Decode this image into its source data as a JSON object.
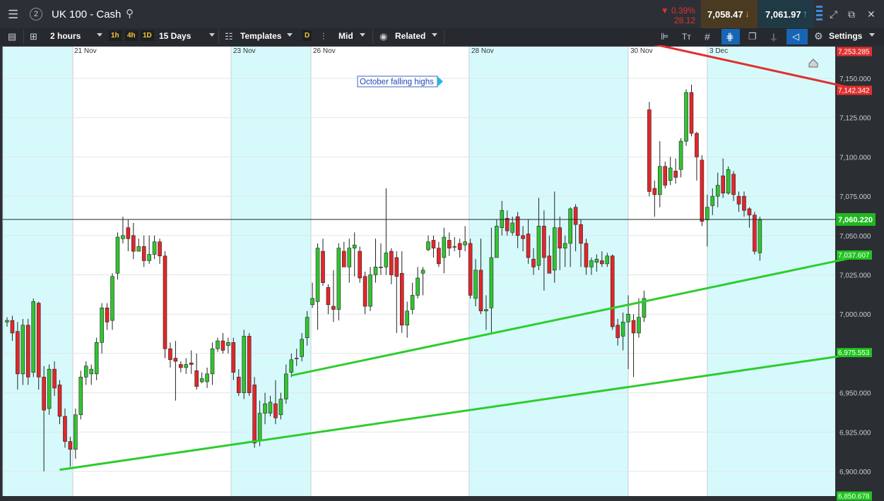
{
  "header": {
    "workspace_number": "2",
    "instrument": "UK 100 - Cash",
    "change_percent": "0.39%",
    "change_points": "28.12",
    "sell_price": "7,058.47",
    "buy_price": "7,061.97",
    "colors": {
      "down": "#e0302f",
      "sell_bg": "#4a3a22",
      "buy_bg": "#1f3a45"
    }
  },
  "toolbar": {
    "interval": "2 hours",
    "timeframes": [
      "1h",
      "4h",
      "1D"
    ],
    "range": "15 Days",
    "templates_label": "Templates",
    "d_badge": "D",
    "price_mode": "Mid",
    "related_label": "Related",
    "settings_label": "Settings"
  },
  "chart_data": {
    "type": "candlestick",
    "ylim": [
      6850,
      7270
    ],
    "y_ticks": [
      "7,150.000",
      "7,125.000",
      "7,100.000",
      "7,075.000",
      "7,050.000",
      "7,025.000",
      "7,000.000",
      "6,975.000",
      "6,950.000",
      "6,925.000",
      "6,900.000"
    ],
    "y_tick_values": [
      7150,
      7125,
      7100,
      7075,
      7050,
      7025,
      7000,
      6975,
      6950,
      6925,
      6900
    ],
    "x_labels": [
      "21 Nov",
      "23 Nov",
      "26 Nov",
      "28 Nov",
      "30 Nov",
      "3 Dec"
    ],
    "shaded_days": 6,
    "current_price": 7060.22,
    "current_price_label": "7,060.220",
    "annotation": "October falling highs",
    "price_tags": [
      {
        "label": "7,253.285",
        "value": 7253.285,
        "color": "#e0302f"
      },
      {
        "label": "7,142.342",
        "value": 7142.342,
        "color": "#e0302f"
      },
      {
        "label": "7,037.607",
        "value": 7037.607,
        "color": "#1fc31f"
      },
      {
        "label": "6,975.553",
        "value": 6975.553,
        "color": "#1fc31f"
      },
      {
        "label": "6,850.678",
        "value": 6850.678,
        "color": "#1fc31f"
      }
    ],
    "trendlines": [
      {
        "name": "resistance",
        "color": "#e0302f",
        "from": [
          13,
          7253
        ],
        "to": [
          163,
          7142
        ]
      },
      {
        "name": "support-upper",
        "color": "#2ecc2e",
        "from": [
          54,
          6961
        ],
        "to": [
          163,
          7037.6
        ]
      },
      {
        "name": "support-lower",
        "color": "#2ecc2e",
        "from": [
          10,
          6901
        ],
        "to": [
          163,
          6975.6
        ]
      }
    ],
    "candles": [
      [
        6995,
        6996,
        6998,
        6992
      ],
      [
        6996,
        6988,
        6999,
        6983
      ],
      [
        6989,
        6962,
        6995,
        6952
      ],
      [
        6962,
        6993,
        6997,
        6955
      ],
      [
        6993,
        6960,
        6997,
        6955
      ],
      [
        6963,
        7008,
        7010,
        6960
      ],
      [
        7007,
        6960,
        7008,
        6952
      ],
      [
        6960,
        6939,
        6967,
        6900
      ],
      [
        6940,
        6965,
        6968,
        6936
      ],
      [
        6965,
        6953,
        6970,
        6948
      ],
      [
        6955,
        6935,
        6958,
        6930
      ],
      [
        6935,
        6919,
        6940,
        6915
      ],
      [
        6919,
        6914,
        6922,
        6903
      ],
      [
        6914,
        6936,
        6940,
        6908
      ],
      [
        6936,
        6960,
        6964,
        6933
      ],
      [
        6960,
        6967,
        6970,
        6955
      ],
      [
        6962,
        6965,
        6968,
        6955
      ],
      [
        6962,
        6982,
        6985,
        6958
      ],
      [
        6982,
        7004,
        7007,
        6975
      ],
      [
        7004,
        6995,
        7007,
        6990
      ],
      [
        6996,
        7024,
        7026,
        6990
      ],
      [
        7026,
        7049,
        7052,
        7022
      ],
      [
        7048,
        7050,
        7062,
        7045
      ],
      [
        7055,
        7048,
        7060,
        7040
      ],
      [
        7050,
        7040,
        7058,
        7035
      ],
      [
        7040,
        7043,
        7048,
        7040
      ],
      [
        7043,
        7034,
        7050,
        7030
      ],
      [
        7034,
        7038,
        7050,
        7032
      ],
      [
        7038,
        7046,
        7050,
        7035
      ],
      [
        7046,
        7037,
        7048,
        7032
      ],
      [
        7037,
        6978,
        7040,
        6972
      ],
      [
        6978,
        6971,
        6982,
        6966
      ],
      [
        6972,
        6970,
        6983,
        6945
      ],
      [
        6968,
        6966,
        6970,
        6963
      ],
      [
        6966,
        6968,
        6972,
        6962
      ],
      [
        6969,
        6968,
        6977,
        6962
      ],
      [
        6964,
        6954,
        6975,
        6952
      ],
      [
        6957,
        6959,
        6963,
        6956
      ],
      [
        6957,
        6962,
        6966,
        6953
      ],
      [
        6962,
        6978,
        6982,
        6955
      ],
      [
        6978,
        6983,
        6985,
        6976
      ],
      [
        6983,
        6977,
        6988,
        6975
      ],
      [
        6980,
        6982,
        6985,
        6975
      ],
      [
        6982,
        6963,
        6985,
        6958
      ],
      [
        6960,
        6950,
        6965,
        6948
      ],
      [
        6950,
        6986,
        6990,
        6946
      ],
      [
        6986,
        6950,
        6988,
        6948
      ],
      [
        6955,
        6918,
        6960,
        6915
      ],
      [
        6920,
        6937,
        6945,
        6916
      ],
      [
        6937,
        6943,
        6950,
        6930
      ],
      [
        6937,
        6944,
        6948,
        6935
      ],
      [
        6943,
        6934,
        6958,
        6930
      ],
      [
        6936,
        6946,
        6950,
        6933
      ],
      [
        6946,
        6962,
        6968,
        6943
      ],
      [
        6963,
        6971,
        6975,
        6960
      ],
      [
        6972,
        6972,
        6978,
        6967
      ],
      [
        6973,
        6984,
        6988,
        6970
      ],
      [
        6985,
        6998,
        7002,
        6980
      ],
      [
        7006,
        7010,
        7020,
        7004
      ],
      [
        7008,
        7042,
        7045,
        6990
      ],
      [
        7040,
        7020,
        7048,
        7018
      ],
      [
        7017,
        7006,
        7019,
        7000
      ],
      [
        7005,
        7003,
        7028,
        6995
      ],
      [
        7003,
        7042,
        7045,
        6996
      ],
      [
        7040,
        7030,
        7046,
        7035
      ],
      [
        7030,
        7042,
        7048,
        7020
      ],
      [
        7042,
        7044,
        7052,
        7024
      ],
      [
        7040,
        7023,
        7043,
        7020
      ],
      [
        7024,
        7005,
        7027,
        7000
      ],
      [
        7005,
        7025,
        7030,
        7002
      ],
      [
        7025,
        7030,
        7048,
        7020
      ],
      [
        7030,
        7030,
        7045,
        7025
      ],
      [
        7030,
        7039,
        7080,
        7025
      ],
      [
        7040,
        7025,
        7042,
        7019
      ],
      [
        7036,
        7024,
        7040,
        6988
      ],
      [
        7026,
        6993,
        7040,
        6988
      ],
      [
        6993,
        7002,
        7008,
        6985
      ],
      [
        7003,
        7012,
        7020,
        7000
      ],
      [
        7012,
        7023,
        7030,
        7010
      ],
      [
        7026,
        7028,
        7030,
        7012
      ],
      [
        7041,
        7046,
        7050,
        7040
      ],
      [
        7047,
        7042,
        7050,
        7036
      ],
      [
        7042,
        7032,
        7046,
        7030
      ],
      [
        7036,
        7049,
        7055,
        7026
      ],
      [
        7047,
        7042,
        7052,
        7037
      ],
      [
        7043,
        7043,
        7049,
        7040
      ],
      [
        7045,
        7041,
        7048,
        7036
      ],
      [
        7044,
        7046,
        7056,
        7040
      ],
      [
        7045,
        7012,
        7048,
        7010
      ],
      [
        7010,
        7028,
        7035,
        7005
      ],
      [
        7028,
        7002,
        7048,
        7000
      ],
      [
        7002,
        7003,
        7012,
        6990
      ],
      [
        7004,
        7036,
        7055,
        6988
      ],
      [
        7036,
        7056,
        7060,
        7050
      ],
      [
        7055,
        7066,
        7072,
        7050
      ],
      [
        7061,
        7053,
        7066,
        7050
      ],
      [
        7052,
        7058,
        7062,
        7050
      ],
      [
        7062,
        7050,
        7065,
        7042
      ],
      [
        7050,
        7048,
        7056,
        7040
      ],
      [
        7051,
        7036,
        7060,
        7032
      ],
      [
        7035,
        7030,
        7042,
        7025
      ],
      [
        7031,
        7056,
        7074,
        7028
      ],
      [
        7056,
        7036,
        7066,
        7015
      ],
      [
        7037,
        7026,
        7050,
        7028
      ],
      [
        7028,
        7055,
        7078,
        7020
      ],
      [
        7055,
        7042,
        7062,
        7028
      ],
      [
        7042,
        7045,
        7050,
        7030
      ],
      [
        7045,
        7067,
        7068,
        7030
      ],
      [
        7068,
        7057,
        7070,
        7040
      ],
      [
        7057,
        7045,
        7060,
        7030
      ],
      [
        7045,
        7030,
        7048,
        7025
      ],
      [
        7030,
        7034,
        7036,
        7025
      ],
      [
        7033,
        7035,
        7038,
        7027
      ],
      [
        7034,
        7032,
        7040,
        7030
      ],
      [
        7032,
        7037,
        7039,
        7030
      ],
      [
        7037,
        6992,
        7038,
        6990
      ],
      [
        6993,
        6985,
        6997,
        6980
      ],
      [
        6986,
        6995,
        7001,
        6977
      ],
      [
        6995,
        7000,
        7012,
        6965
      ],
      [
        6996,
        6988,
        7000,
        6960
      ],
      [
        6988,
        6998,
        7010,
        6985
      ],
      [
        6998,
        7010,
        7015,
        6995
      ],
      [
        7130,
        7078,
        7135,
        7075
      ],
      [
        7080,
        7076,
        7085,
        7062
      ],
      [
        7076,
        7094,
        7110,
        7068
      ],
      [
        7094,
        7082,
        7097,
        7080
      ],
      [
        7085,
        7093,
        7100,
        7082
      ],
      [
        7091,
        7087,
        7099,
        7083
      ],
      [
        7092,
        7110,
        7112,
        7087
      ],
      [
        7110,
        7141,
        7143,
        7107
      ],
      [
        7141,
        7115,
        7146,
        7113
      ],
      [
        7115,
        7100,
        7116,
        7085
      ],
      [
        7098,
        7059,
        7101,
        7056
      ],
      [
        7060,
        7068,
        7076,
        7043
      ],
      [
        7069,
        7075,
        7080,
        7063
      ],
      [
        7075,
        7082,
        7090,
        7068
      ],
      [
        7088,
        7077,
        7099,
        7074
      ],
      [
        7077,
        7092,
        7094,
        7076
      ],
      [
        7089,
        7076,
        7091,
        7072
      ],
      [
        7075,
        7070,
        7078,
        7065
      ],
      [
        7075,
        7066,
        7078,
        7062
      ],
      [
        7067,
        7063,
        7068,
        7055
      ],
      [
        7063,
        7040,
        7065,
        7038
      ],
      [
        7039,
        7060,
        7062,
        7034
      ]
    ]
  }
}
